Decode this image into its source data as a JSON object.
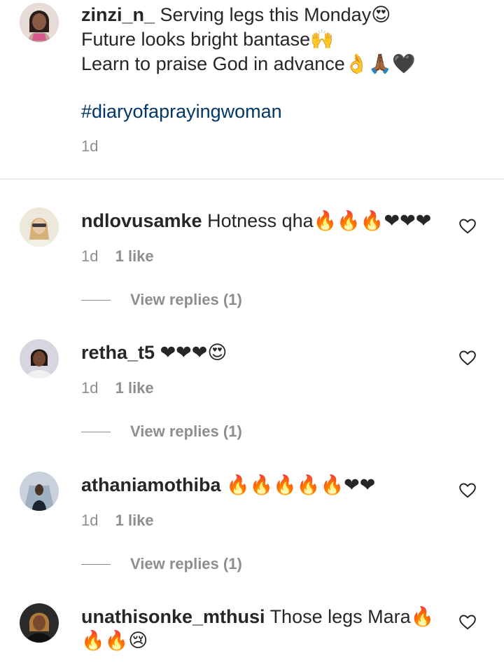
{
  "caption": {
    "username": "zinzi_n_",
    "lines": [
      "Serving legs this Monday😍",
      "Future looks bright bantase🙌",
      "Learn to praise God in advance👌🙏🏾🖤"
    ],
    "hashtag": "#diaryofaprayingwoman",
    "time": "1d"
  },
  "comments": [
    {
      "username": "ndlovusamke",
      "text": "Hotness qha🔥🔥🔥❤❤❤",
      "time": "1d",
      "likes": "1 like",
      "replies": "View replies (1)"
    },
    {
      "username": "retha_t5",
      "text": "❤❤❤😍",
      "time": "1d",
      "likes": "1 like",
      "replies": "View replies (1)"
    },
    {
      "username": "athaniamothiba",
      "text": "🔥🔥🔥🔥🔥❤❤",
      "time": "1d",
      "likes": "1 like",
      "replies": "View replies (1)"
    },
    {
      "username": "unathisonke_mthusi",
      "text": "Those legs Mara🔥🔥🔥😢"
    }
  ],
  "icons": {
    "like": "heart-outline-icon"
  },
  "colors": {
    "text": "#262626",
    "secondary": "#8e8e8e",
    "hashtag": "#00376b",
    "divider": "#dbdbdb"
  }
}
